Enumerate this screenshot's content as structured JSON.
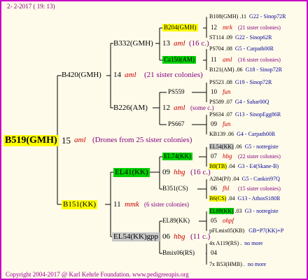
{
  "header": {
    "date_line": "2- 2-2017 ( 19: 13)"
  },
  "footer": {
    "copyright": "Copyright 2004-2017 @ Karl Kehrle Foundation.   www.pedigreeapis.org"
  },
  "root": {
    "name": "B519(GMH)",
    "year": "15",
    "mark": "aml",
    "note": "(Drones from 25 sister colonies)"
  },
  "gen1": [
    {
      "name": "B420(GMH)",
      "year": "14",
      "mark": "aml",
      "note": "(21 sister colonies)"
    },
    {
      "name": "B151(KK)",
      "year": "11",
      "mark": "mmk",
      "note": "(6 sister colonies)"
    }
  ],
  "gen2": [
    {
      "name": "B332(GMH)",
      "year": "13",
      "mark": "aml",
      "note": "(16 c.)"
    },
    {
      "name": "B226(AM)",
      "year": "12",
      "mark": "aml",
      "note": "(some c.)"
    },
    {
      "name": "EL41(KK)",
      "year": "09",
      "mark": "hbg",
      "note": "(16 c.)"
    },
    {
      "name": "EL54(KK)gpp",
      "year": "06",
      "mark": "hbg",
      "note": "(11 c.)"
    }
  ],
  "gen3": [
    {
      "name": "B204(GMH)",
      "year": "12",
      "mark": "mrk",
      "note": "(21 sister colonies)"
    },
    {
      "name": "Ca150(AM)",
      "year": "11",
      "mark": "aml",
      "note": "(16 sister colonies)"
    },
    {
      "name": "PS559",
      "year": "10",
      "mark": "fun",
      "note": ""
    },
    {
      "name": "PS667",
      "year": "09",
      "mark": "fun",
      "note": ""
    },
    {
      "name": "EL74(KK)",
      "year": "07",
      "mark": "hbg",
      "note": "(22 sister colonies)"
    },
    {
      "name": "B351(CS)",
      "year": "06",
      "mark": "fhl",
      "note": "(15 sister colonies)"
    },
    {
      "name": "EL89(KK)",
      "year": "05",
      "mark": "ohpf",
      "note": ""
    },
    {
      "name": "Bmix06(RS)",
      "year": "04",
      "mark": "",
      "note": ""
    }
  ],
  "gen4": [
    {
      "name": "B108(GMH)",
      "mid": ".11",
      "info": "G22 - Sinop72R"
    },
    {
      "name": "ST114",
      "mid": ".09",
      "info": "G22 - Sinop62R"
    },
    {
      "name": "PS704",
      "mid": ".08",
      "info": "G5 - Carpath00R"
    },
    {
      "name": "B121(AM)",
      "mid": ".06",
      "info": "G18 - Sinop72R"
    },
    {
      "name": "PS523",
      "mid": ".08",
      "info": "G19 - Sinop72R"
    },
    {
      "name": "PS589",
      "mid": ".07",
      "info": "G4 - Sahar00Q"
    },
    {
      "name": "PS634",
      "mid": ".07",
      "info": "G13 - SinopEgg86R"
    },
    {
      "name": "KB139",
      "mid": ".06",
      "info": "G4 - Carpath00R"
    },
    {
      "name": "EL54(KK)",
      "mid": ".06",
      "info": "G5 - notregiste"
    },
    {
      "name": "B8(TB)",
      "mid": ".04",
      "info": "G3 - E4(Skane-B)"
    },
    {
      "name": "A284(PJ)",
      "mid": ".04",
      "info": "G5 - Cankiri97Q"
    },
    {
      "name": "B6(CS)",
      "mid": ".04",
      "info": "G13 - AthosS180R"
    },
    {
      "name": "EL89(KK)",
      "mid": ".03",
      "info": "G3 - notregiste"
    },
    {
      "name": "pFLmix05(KB)",
      "mid": "",
      "info": "GB=P7(KK)+P"
    },
    {
      "name": "4x A119(RS)",
      "mid": ".",
      "info": "no more"
    },
    {
      "name": "7x B53(HMB)",
      "mid": ".",
      "info": "no more"
    }
  ],
  "colors": {
    "border": "#c800c8",
    "bg": "#fffbea",
    "yellow": "#ffff00",
    "green": "#00d000",
    "grey": "#c8c8c8",
    "line": "#000000"
  }
}
